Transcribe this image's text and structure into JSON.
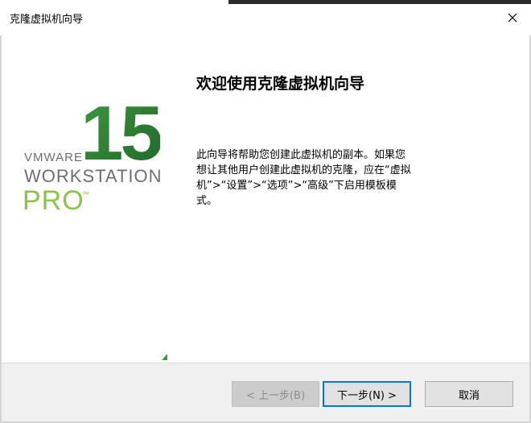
{
  "window": {
    "title": "克隆虚拟机向导",
    "close_icon": "close-icon"
  },
  "brand": {
    "number": "15",
    "vmware": "VMWARE",
    "product": "WORKSTATION",
    "edition": "PRO",
    "trademark": "™",
    "accent_green": "#3b9a3e",
    "light_green": "#8bc34a",
    "gray": "#6e6e6e"
  },
  "content": {
    "heading": "欢迎使用克隆虚拟机向导",
    "description": "此向导将帮助您创建此虚拟机的副本。如果您想让其他用户创建此虚拟机的克隆，应在“虚拟机”>“设置”>“选项”>“高级”下启用模板模式。"
  },
  "buttons": {
    "back": "< 上一步(B)",
    "next": "下一步(N) >",
    "cancel": "取消"
  },
  "colors": {
    "focus_border": "#0078d7",
    "footer_bg": "#f0f0f0"
  }
}
